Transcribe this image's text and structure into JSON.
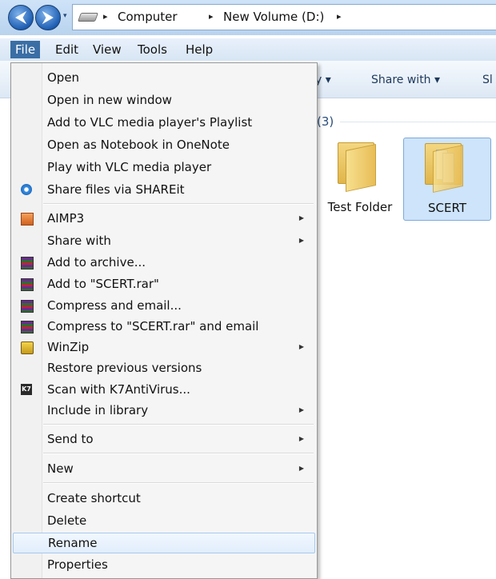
{
  "address_bar": {
    "back_glyph": "⮜",
    "forward_glyph": "⮞",
    "recent_glyph": "▾",
    "breadcrumb": [
      "Computer",
      "New Volume (D:)"
    ],
    "separator": "▸"
  },
  "menubar": [
    "File",
    "Edit",
    "View",
    "Tools",
    "Help"
  ],
  "toolbar": {
    "partial_library": "y ▾",
    "share_with": "Share with ▾",
    "partial_next": "Sl"
  },
  "content": {
    "group_count": "(3)",
    "items": [
      {
        "name": "Test Folder",
        "selected": false
      },
      {
        "name": "SCERT",
        "selected": true
      }
    ]
  },
  "context_menu": {
    "submenu_glyph": "▶",
    "items": [
      {
        "label": "Open",
        "icon": ""
      },
      {
        "label": "Open in new window",
        "icon": ""
      },
      {
        "label": "Add to VLC media player's Playlist",
        "icon": ""
      },
      {
        "label": "Open as Notebook in OneNote",
        "icon": ""
      },
      {
        "label": "Play with VLC media player",
        "icon": ""
      },
      {
        "label": "Share files via SHAREit",
        "icon": "shareit-icon"
      },
      {
        "label": "AIMP3",
        "icon": "aimp-icon",
        "submenu": true
      },
      {
        "label": "Share with",
        "icon": "",
        "submenu": true
      },
      {
        "label": "Add to archive...",
        "icon": "winrar-icon"
      },
      {
        "label": "Add to \"SCERT.rar\"",
        "icon": "winrar-icon"
      },
      {
        "label": "Compress and email...",
        "icon": "winrar-icon"
      },
      {
        "label": "Compress to \"SCERT.rar\" and email",
        "icon": "winrar-icon"
      },
      {
        "label": "WinZip",
        "icon": "winzip-icon",
        "submenu": true
      },
      {
        "label": "Restore previous versions",
        "icon": ""
      },
      {
        "label": "Scan with K7AntiVirus...",
        "icon": "k7-icon",
        "icon_text": "K7"
      },
      {
        "label": "Include in library",
        "icon": "",
        "submenu": true
      },
      {
        "label": "Send to",
        "icon": "",
        "submenu": true
      },
      {
        "label": "New",
        "icon": "",
        "submenu": true
      },
      {
        "label": "Create shortcut",
        "icon": ""
      },
      {
        "label": "Delete",
        "icon": ""
      },
      {
        "label": "Rename",
        "icon": "",
        "highlighted": true
      },
      {
        "label": "Properties",
        "icon": ""
      }
    ]
  },
  "colors": {
    "menu_active": "#3a6ea5",
    "selection": "#cde4fb"
  }
}
